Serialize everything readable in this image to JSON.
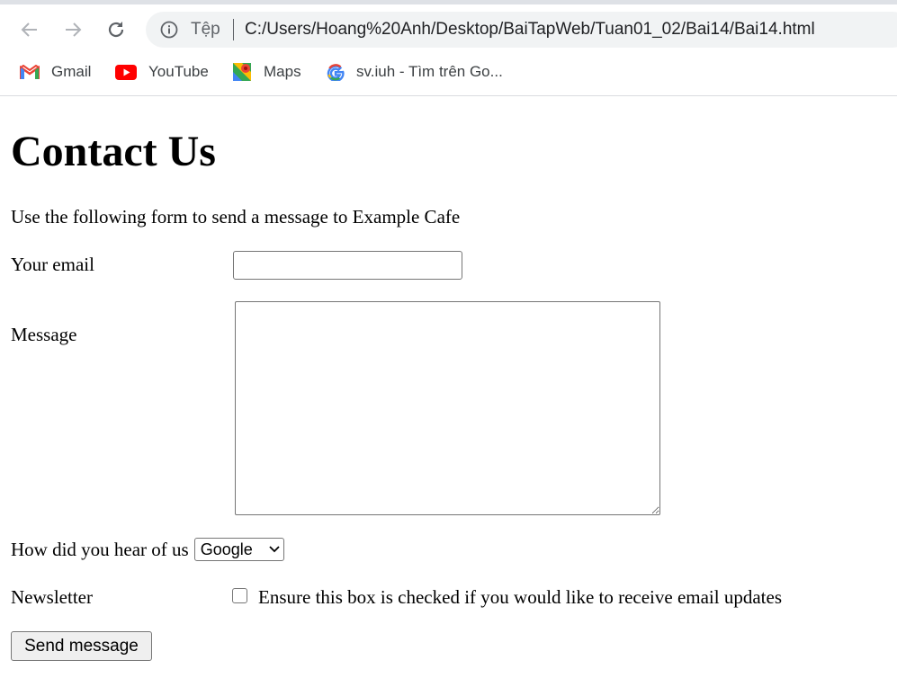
{
  "browser": {
    "address_chip": "Tệp",
    "url": "C:/Users/Hoang%20Anh/Desktop/BaiTapWeb/Tuan01_02/Bai14/Bai14.html",
    "bookmarks": [
      {
        "label": "Gmail"
      },
      {
        "label": "YouTube"
      },
      {
        "label": "Maps"
      },
      {
        "label": "sv.iuh - Tìm trên Go..."
      }
    ]
  },
  "page": {
    "title": "Contact Us",
    "intro": "Use the following form to send a message to Example Cafe",
    "form": {
      "email_label": "Your email",
      "email_value": "",
      "message_label": "Message",
      "message_value": "",
      "heard_label": "How did you hear of us",
      "heard_selected": "Google",
      "newsletter_label": "Newsletter",
      "newsletter_text": "Ensure this box is checked if you would like to receive email updates",
      "newsletter_checked": false,
      "submit_label": "Send message"
    }
  },
  "colors": {
    "chrome_bg": "#dee1e6",
    "omnibox_bg": "#f1f3f4",
    "control_border": "#767676",
    "button_bg": "#efefef"
  }
}
